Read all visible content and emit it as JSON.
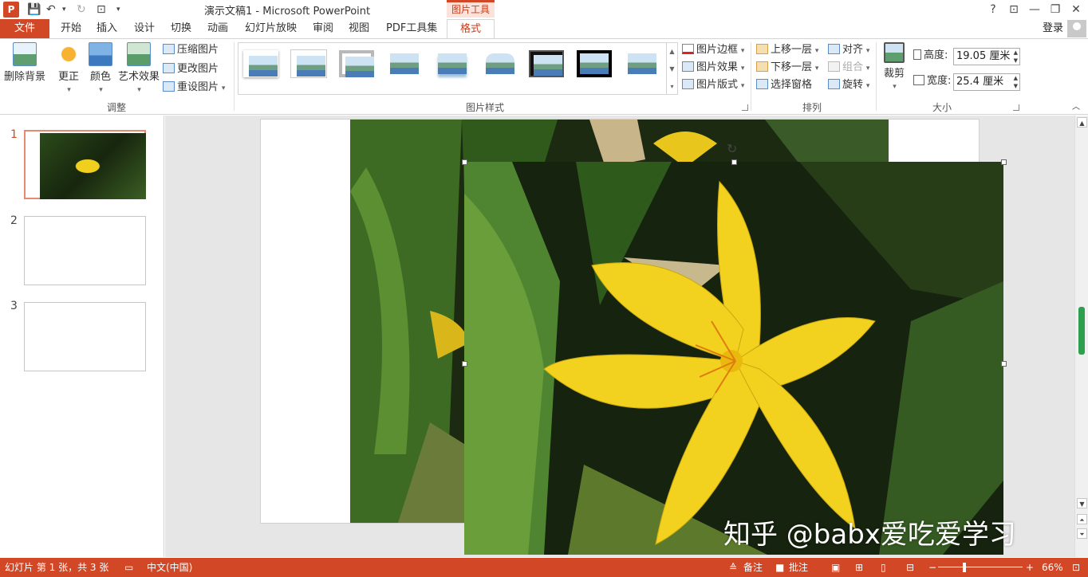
{
  "window": {
    "title": "演示文稿1 - Microsoft PowerPoint",
    "logo": "P",
    "context_tab": "图片工具",
    "help": "?",
    "controls": {
      "restore_ribbon": "⊡",
      "minimize": "—",
      "maximize": "❐",
      "close": "✕"
    }
  },
  "tabs": {
    "file": "文件",
    "items": [
      "开始",
      "插入",
      "设计",
      "切换",
      "动画",
      "幻灯片放映",
      "审阅",
      "视图",
      "PDF工具集"
    ],
    "active": "格式",
    "login": "登录"
  },
  "ribbon": {
    "adjust": {
      "remove_bg": "删除背景",
      "correct": "更正",
      "color": "颜色",
      "artistic": "艺术效果",
      "compress": "压缩图片",
      "change": "更改图片",
      "reset": "重设图片",
      "label": "调整"
    },
    "styles": {
      "border": "图片边框",
      "effects": "图片效果",
      "layout": "图片版式",
      "label": "图片样式"
    },
    "arrange": {
      "bring_forward": "上移一层",
      "send_backward": "下移一层",
      "selection_pane": "选择窗格",
      "align": "对齐",
      "group": "组合",
      "rotate": "旋转",
      "label": "排列"
    },
    "size": {
      "crop": "裁剪",
      "height_label": "高度:",
      "height_value": "19.05 厘米",
      "width_label": "宽度:",
      "width_value": "25.4 厘米",
      "label": "大小"
    }
  },
  "slides": {
    "numbers": [
      "1",
      "2",
      "3"
    ]
  },
  "watermark": "知乎 @babx爱吃爱学习",
  "status": {
    "slide_info": "幻灯片 第 1 张，共 3 张",
    "language": "中文(中国)",
    "notes": "备注",
    "comments": "批注",
    "zoom_minus": "−",
    "zoom_plus": "+",
    "zoom": "66%"
  },
  "colors": {
    "accent": "#d24726",
    "flower": "#f2d21f",
    "foliage": "#2f5a1c"
  }
}
